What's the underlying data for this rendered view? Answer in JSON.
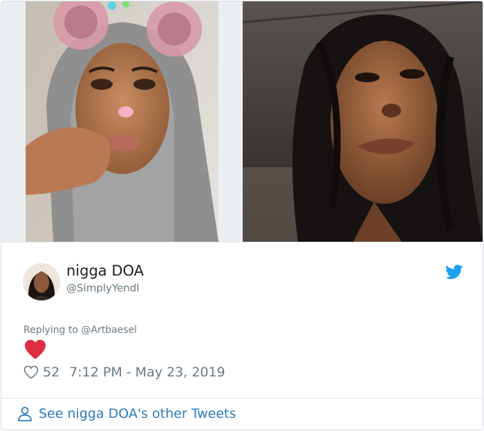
{
  "tweet": {
    "author": {
      "display_name": "nigga DOA",
      "handle": "@SimplyYendl",
      "avatar_icon": "avatar-photo"
    },
    "brand_icon": "twitter-bird-icon",
    "replying_to": "Replying to @Artbaesel",
    "body_emoji": "heart-emoji",
    "likes": "52",
    "timestamp": "7:12 PM - May 23, 2019",
    "media_count": 2
  },
  "footer": {
    "link_label": "See nigga DOA's other Tweets",
    "icon": "person-icon"
  },
  "colors": {
    "link": "#2b7bb9",
    "twitter_blue": "#1da1f2",
    "heart": "#e0245e",
    "secondary_text": "#697882",
    "primary_text": "#1c2022",
    "divider": "#e1e8ed"
  }
}
